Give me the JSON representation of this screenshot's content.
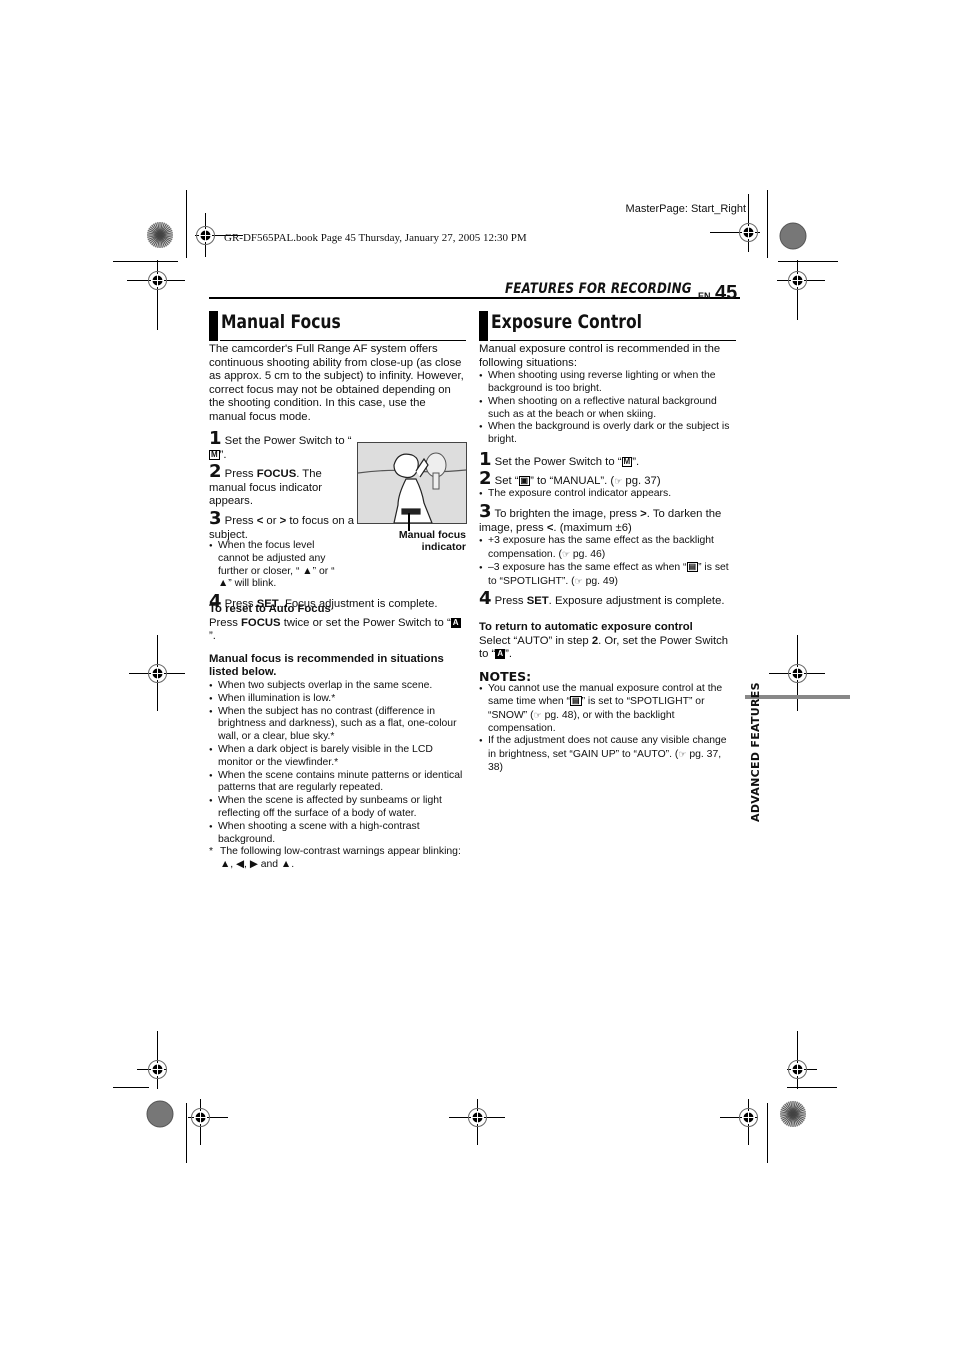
{
  "meta": {
    "master_page": "MasterPage: Start_Right",
    "book_info": "GR-DF565PAL.book  Page 45  Thursday, January 27, 2005  12:30 PM"
  },
  "header": {
    "section": "FEATURES FOR RECORDING",
    "lang": "EN",
    "page": "45"
  },
  "side_tab": "ADVANCED FEATURES",
  "manual_focus": {
    "title": "Manual Focus",
    "intro": "The camcorder's Full Range AF system offers continuous shooting ability from close-up (as close as approx. 5 cm to the subject) to infinity. However, correct focus may not be obtained depending on the shooting condition. In this case, use the manual focus mode.",
    "steps": [
      {
        "num": "1",
        "pre": "Set the Power Switch to “",
        "icon": "M",
        "post": "”."
      },
      {
        "num": "2",
        "pre": "Press ",
        "bold": "FOCUS",
        "post": ". The manual focus indicator appears."
      },
      {
        "num": "3",
        "pre": "Press ",
        "bold": "<",
        "mid": " or ",
        "bold2": ">",
        "post": " to focus on a subject."
      },
      {
        "num": "4",
        "pre": "Press ",
        "bold": "SET",
        "post": ". Focus adjustment is complete."
      }
    ],
    "step3_note": "When the focus level cannot be adjusted any further or closer, “ ▲” or “ ▲” will blink.",
    "figure_caption": "Manual focus indicator",
    "reset": {
      "heading": "To reset to Auto Focus",
      "pre": "Press ",
      "bold": "FOCUS",
      "post": " twice or set the Power Switch to “",
      "icon": "A",
      "end": "”."
    },
    "recommend_heading": "Manual focus is recommended in situations listed below.",
    "recommend_items": [
      "When two subjects overlap in the same scene.",
      "When illumination is low.*",
      "When the subject has no contrast (difference in brightness and darkness), such as a flat, one-colour wall, or a clear, blue sky.*",
      "When a dark object is barely visible in the LCD monitor or the viewfinder.*",
      "When the scene contains minute patterns or identical patterns that are regularly repeated.",
      "When the scene is affected by sunbeams or light reflecting off the surface of a body of water.",
      "When shooting a scene with a high-contrast background."
    ],
    "footnote": "The following low-contrast warnings appear blinking: ▲, ◀, ▶ and ▲."
  },
  "exposure": {
    "title": "Exposure Control",
    "intro": "Manual exposure control is recommended in the following situations:",
    "situations": [
      "When shooting using reverse lighting or when the background is too bright.",
      "When shooting on a reflective natural background such as at the beach or when skiing.",
      "When the background is overly dark or the subject is bright."
    ],
    "step1": {
      "num": "1",
      "pre": "Set the Power Switch to “",
      "icon": "M",
      "post": "”."
    },
    "step2": {
      "num": "2",
      "pre": "Set “",
      "icon": "▣",
      "post": "” to “MANUAL”. (",
      "ref": "pg. 37)"
    },
    "step2_note": "The exposure control indicator appears.",
    "step3": {
      "num": "3",
      "pre": "To brighten the image, press ",
      "b1": ">",
      "mid": ". To darken the image, press ",
      "b2": "<",
      "post": ". (maximum ±6)"
    },
    "step3_notes": [
      {
        "text": "+3 exposure has the same effect as the backlight compensation. (",
        "ref": "pg. 46)"
      },
      {
        "text": "–3 exposure has the same effect as when “",
        "icon": "▤",
        "text2": "” is set to “SPOTLIGHT”. (",
        "ref": "pg. 49)"
      }
    ],
    "step4": {
      "num": "4",
      "pre": "Press ",
      "bold": "SET",
      "post": ". Exposure adjustment is complete."
    },
    "return": {
      "heading": "To return to automatic exposure control",
      "pre": "Select “AUTO” in step ",
      "bold": "2",
      "post": ". Or, set the Power Switch to “",
      "icon": "A",
      "end": "”."
    },
    "notes_heading": "NOTES:",
    "notes": [
      {
        "pre": "You cannot use the manual exposure control at the same time when “",
        "icon": "▤",
        "post": "” is set to “SPOTLIGHT” or “SNOW” (",
        "ref": "pg. 48), or with the backlight compensation."
      },
      {
        "pre": "If the adjustment does not cause any visible change in brightness, set “GAIN UP” to “AUTO”. (",
        "ref": "pg. 37, 38)"
      }
    ],
    "pointer_icon": "☞"
  }
}
